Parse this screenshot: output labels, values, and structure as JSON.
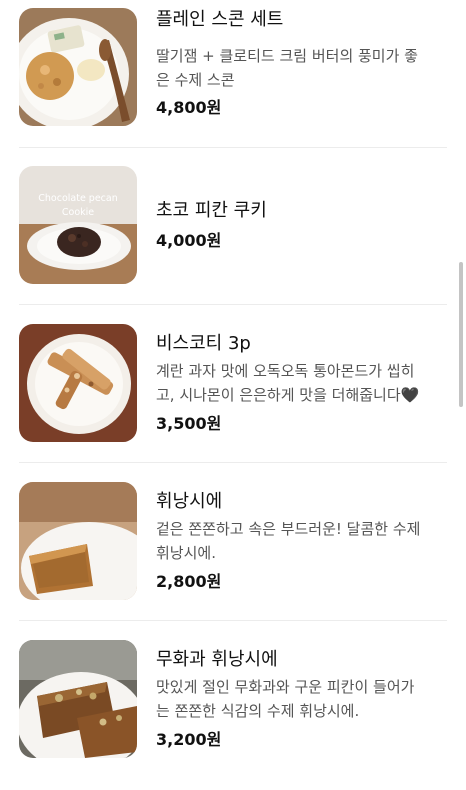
{
  "items": [
    {
      "name": "플레인 스콘 세트",
      "desc_lines": [
        "딸기잼 + 클로티드 크림 버터의 풍미가 좋",
        "은 수제 스콘"
      ],
      "price": "4,800원",
      "image_icon": "scone-photo"
    },
    {
      "name": "초코 피칸 쿠키",
      "desc_lines": [],
      "price": "4,000원",
      "image_icon": "cookie-photo",
      "photo_caption": [
        "Chocolate pecan",
        "Cookie"
      ]
    },
    {
      "name": "비스코티 3p",
      "desc_lines": [
        "계란 과자 맛에 오독오독 통아몬드가 씹히",
        "고, 시나몬이 은은하게 맛을 더해줍니다🖤"
      ],
      "price": "3,500원",
      "image_icon": "biscotti-photo"
    },
    {
      "name": "휘낭시에",
      "desc_lines": [
        "겉은 쫀쫀하고 속은 부드러운! 달콤한 수제",
        "휘낭시에."
      ],
      "price": "2,800원",
      "image_icon": "financier-photo"
    },
    {
      "name": "무화과 휘낭시에",
      "desc_lines": [
        "맛있게 절인 무화과와 구운 피칸이 들어가",
        "는 쫀쫀한 식감의 수제 휘낭시에."
      ],
      "price": "3,200원",
      "image_icon": "fig-financier-photo"
    }
  ]
}
